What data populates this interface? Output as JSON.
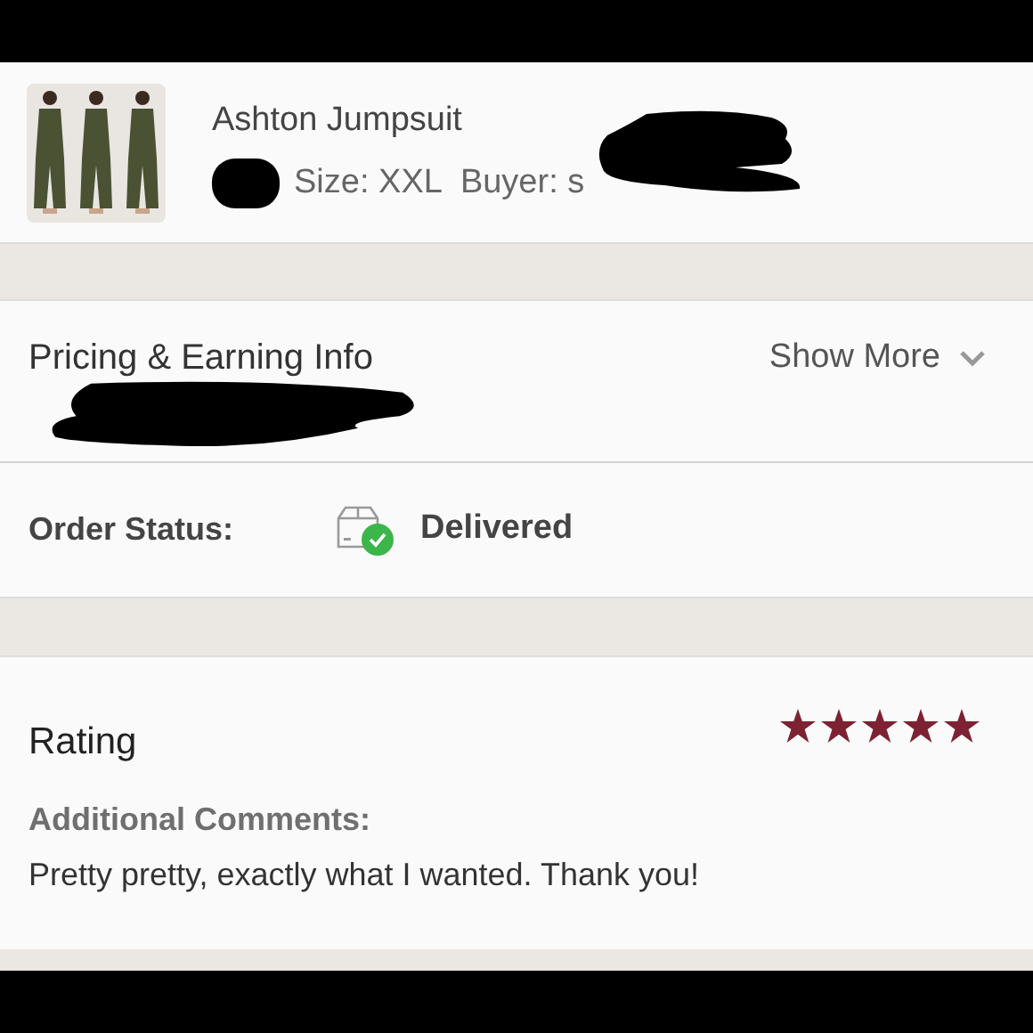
{
  "item": {
    "title": "Ashton Jumpsuit",
    "size": "Size: XXL",
    "buyer": "Buyer: s"
  },
  "pricing": {
    "title": "Pricing & Earning Info",
    "toggle": "Show More",
    "expanded": false
  },
  "order_status": {
    "label": "Order Status:",
    "value": "Delivered"
  },
  "rating": {
    "label": "Rating",
    "stars": 5,
    "comments_label": "Additional Comments:",
    "comment": "Pretty pretty, exactly what I wanted. Thank you!"
  }
}
